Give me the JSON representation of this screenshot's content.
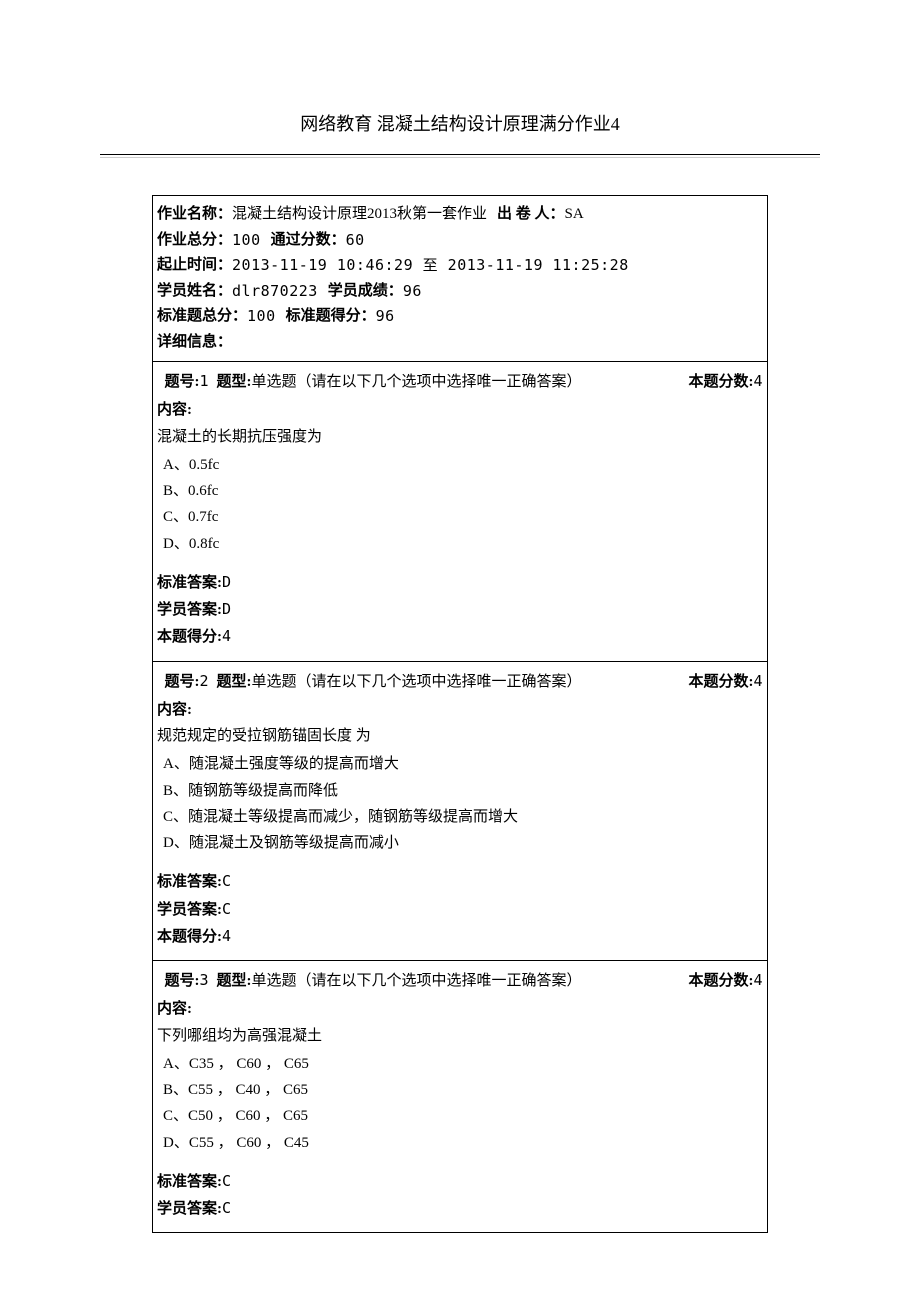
{
  "title": {
    "t1": "网络教育",
    "t2": "混凝土结构设计原理",
    "t3": "满分作业4"
  },
  "header": {
    "name_label": "作业名称：",
    "name_value": "混凝土结构设计原理2013秋第一套作业",
    "author_label": "出 卷 人：",
    "author_value": "SA",
    "total_label": "作业总分：",
    "total_value": "100",
    "pass_label": "通过分数：",
    "pass_value": "60",
    "time_label": "起止时间：",
    "time_value": "2013-11-19 10:46:29 至 2013-11-19 11:25:28",
    "student_label": "学员姓名：",
    "student_value": "dlr870223",
    "score_label": "学员成绩：",
    "score_value": "96",
    "std_total_label": "标准题总分：",
    "std_total_value": "100",
    "std_score_label": "标准题得分：",
    "std_score_value": "96",
    "detail_label": "详细信息："
  },
  "labels": {
    "qnum": "题号:",
    "qtype": "题型:",
    "qtype_value": "单选题（请在以下几个选项中选择唯一正确答案）",
    "qscore": "本题分数:",
    "content": "内容:",
    "std_ans": "标准答案:",
    "stu_ans": "学员答案:",
    "got": "本题得分:"
  },
  "questions": [
    {
      "num": "1",
      "score": "4",
      "content": "混凝土的长期抗压强度为",
      "options": [
        "A、0.5fc",
        "B、0.6fc",
        "C、0.7fc",
        "D、0.8fc"
      ],
      "std_ans": "D",
      "stu_ans": "D",
      "got": "4"
    },
    {
      "num": "2",
      "score": "4",
      "content": "规范规定的受拉钢筋锚固长度 为",
      "options": [
        "A、随混凝土强度等级的提高而增大",
        "B、随钢筋等级提高而降低",
        "C、随混凝土等级提高而减少，随钢筋等级提高而增大",
        "D、随混凝土及钢筋等级提高而减小"
      ],
      "std_ans": "C",
      "stu_ans": "C",
      "got": "4"
    },
    {
      "num": "3",
      "score": "4",
      "content": "下列哪组均为高强混凝土",
      "options": [
        "A、C35 ， C60 ， C65",
        "B、C55 ， C40 ， C65",
        "C、C50 ， C60 ， C65",
        "D、C55 ， C60 ， C45"
      ],
      "std_ans": "C",
      "stu_ans": "C",
      "got": null
    }
  ]
}
